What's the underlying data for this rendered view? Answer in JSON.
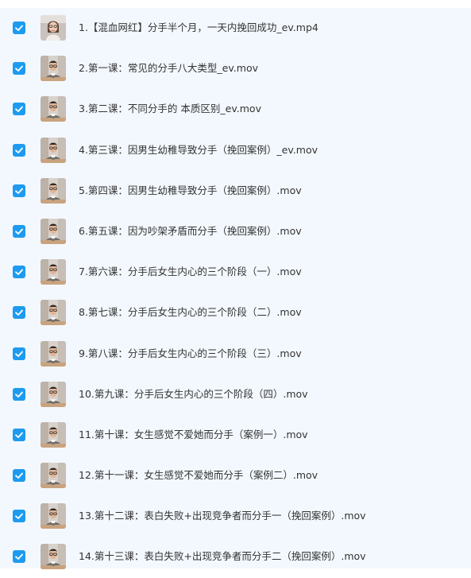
{
  "accent_color": "#1e9bf0",
  "files": [
    {
      "label": "1.【混血网红】分手半个月，一天内挽回成功_ev.mp4",
      "checked": true,
      "thumbnail": "portrait-woman-thumbnail"
    },
    {
      "label": "2.第一课：常见的分手八大类型_ev.mov",
      "checked": true,
      "thumbnail": "lecturer-video-thumbnail"
    },
    {
      "label": "3.第二课：不同分手的 本质区别_ev.mov",
      "checked": true,
      "thumbnail": "lecturer-video-thumbnail"
    },
    {
      "label": "4.第三课：因男生幼稚导致分手（挽回案例）_ev.mov",
      "checked": true,
      "thumbnail": "lecturer-video-thumbnail"
    },
    {
      "label": "5.第四课：因男生幼稚导致分手（挽回案例）.mov",
      "checked": true,
      "thumbnail": "lecturer-video-thumbnail"
    },
    {
      "label": "6.第五课：因为吵架矛盾而分手（挽回案例）.mov",
      "checked": true,
      "thumbnail": "lecturer-video-thumbnail"
    },
    {
      "label": "7.第六课：分手后女生内心的三个阶段（一）.mov",
      "checked": true,
      "thumbnail": "lecturer-video-thumbnail"
    },
    {
      "label": "8.第七课：分手后女生内心的三个阶段（二）.mov",
      "checked": true,
      "thumbnail": "lecturer-video-thumbnail"
    },
    {
      "label": "9.第八课：分手后女生内心的三个阶段（三）.mov",
      "checked": true,
      "thumbnail": "lecturer-video-thumbnail"
    },
    {
      "label": "10.第九课：分手后女生内心的三个阶段（四）.mov",
      "checked": true,
      "thumbnail": "lecturer-video-thumbnail"
    },
    {
      "label": "11.第十课：女生感觉不爱她而分手（案例一）.mov",
      "checked": true,
      "thumbnail": "lecturer-video-thumbnail"
    },
    {
      "label": "12.第十一课：女生感觉不爱她而分手（案例二）.mov",
      "checked": true,
      "thumbnail": "lecturer-video-thumbnail"
    },
    {
      "label": "13.第十二课：表白失败+出现竞争者而分手一（挽回案例）.mov",
      "checked": true,
      "thumbnail": "lecturer-video-thumbnail"
    },
    {
      "label": "14.第十三课：表白失败+出现竞争者而分手二（挽回案例）.mov",
      "checked": true,
      "thumbnail": "lecturer-video-thumbnail"
    }
  ]
}
